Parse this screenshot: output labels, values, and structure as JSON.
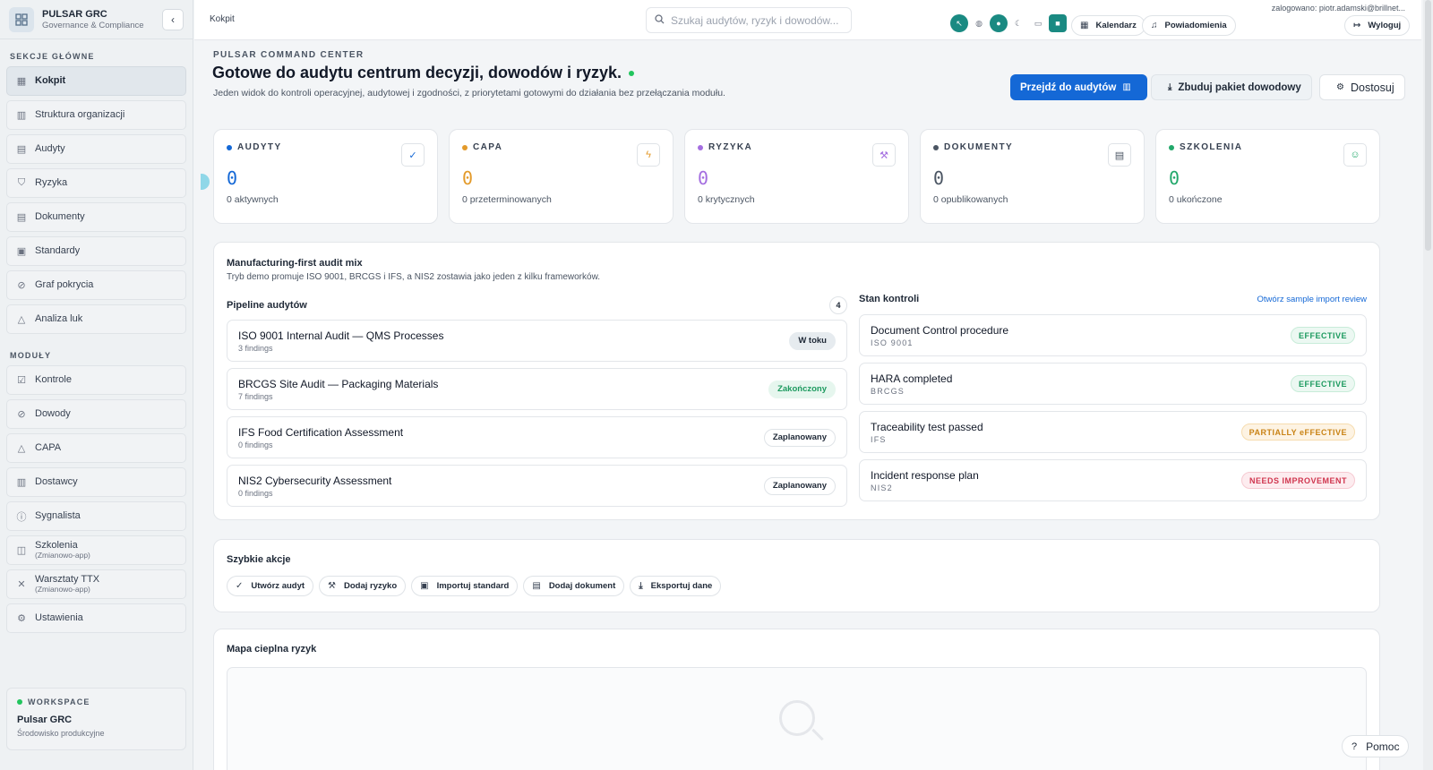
{
  "brand": {
    "title": "PULSAR GRC",
    "subtitle": "Governance & Compliance"
  },
  "sidebar": {
    "section_main": "SEKCJE GŁÓWNE",
    "main_items": [
      {
        "label": "Kokpit",
        "icon": "dashboard-icon"
      },
      {
        "label": "Struktura organizacji",
        "icon": "building-icon"
      },
      {
        "label": "Audyty",
        "icon": "clipboard-icon"
      },
      {
        "label": "Ryzyka",
        "icon": "shield-icon"
      },
      {
        "label": "Dokumenty",
        "icon": "document-icon"
      },
      {
        "label": "Standardy",
        "icon": "book-icon"
      },
      {
        "label": "Graf pokrycia",
        "icon": "check-circle-icon"
      },
      {
        "label": "Analiza luk",
        "icon": "warning-icon"
      }
    ],
    "section_modules": "MODUŁY",
    "module_items": [
      {
        "label": "Kontrole",
        "sub": "",
        "icon": "checkbox-icon"
      },
      {
        "label": "Dowody",
        "sub": "",
        "icon": "check-circle-icon"
      },
      {
        "label": "CAPA",
        "sub": "",
        "icon": "warning-icon"
      },
      {
        "label": "Dostawcy",
        "sub": "",
        "icon": "building-icon"
      },
      {
        "label": "Sygnalista",
        "sub": "",
        "icon": "info-icon"
      },
      {
        "label": "Szkolenia",
        "sub": "(Zmianowo-app)",
        "icon": "book-open-icon"
      },
      {
        "label": "Warsztaty TTX",
        "sub": "(Zmianowo-app)",
        "icon": "tools-icon"
      },
      {
        "label": "Ustawienia",
        "sub": "",
        "icon": "gear-icon"
      }
    ]
  },
  "workspace": {
    "label": "WORKSPACE",
    "name": "Pulsar GRC",
    "env": "Środowisko produkcyjne"
  },
  "topbar": {
    "breadcrumb": "Kokpit",
    "search_placeholder": "Szukaj audytów, ryzyk i dowodów...",
    "logged_in": "zalogowano: piotr.adamski@brillnet...",
    "calendar": "Kalendarz",
    "notifications": "Powiadomienia",
    "logout": "Wyloguj"
  },
  "header": {
    "eyebrow": "PULSAR COMMAND CENTER",
    "title": "Gotowe do audytu centrum decyzji, dowodów i ryzyk.",
    "lead": "Jeden widok do kontroli operacyjnej, audytowej i zgodności, z priorytetami gotowymi do działania bez przełączania modułu.",
    "btn_audits": "Przejdź do audytów",
    "btn_evidence": "Zbuduj pakiet dowodowy",
    "btn_customize": "Dostosuj"
  },
  "kpis": [
    {
      "label": "AUDYTY",
      "value": "0",
      "sub": "0 aktywnych",
      "color": "#1468d6",
      "icon": "check-icon",
      "glyph": "✓"
    },
    {
      "label": "CAPA",
      "value": "0",
      "sub": "0 przeterminowanych",
      "color": "#e39a2a",
      "icon": "lightning-icon",
      "glyph": "ϟ"
    },
    {
      "label": "RYZYKA",
      "value": "0",
      "sub": "0 krytycznych",
      "color": "#a46ee0",
      "icon": "hammer-icon",
      "glyph": "⚒"
    },
    {
      "label": "DOKUMENTY",
      "value": "0",
      "sub": "0 opublikowanych",
      "color": "#4b5563",
      "icon": "document-icon",
      "glyph": "▤"
    },
    {
      "label": "SZKOLENIA",
      "value": "0",
      "sub": "0 ukończone",
      "color": "#22a86b",
      "icon": "users-icon",
      "glyph": "☺"
    }
  ],
  "audit_mix": {
    "title": "Manufacturing-first audit mix",
    "subtitle": "Tryb demo promuje ISO 9001, BRCGS i IFS, a NIS2 zostawia jako jeden z kilku frameworków.",
    "pipeline_title": "Pipeline audytów",
    "pipeline_count": "4",
    "pipeline": [
      {
        "name": "ISO 9001 Internal Audit — QMS Processes",
        "meta": "3 findings",
        "status": "W toku",
        "bg": "#e6ebef",
        "fg": "#1f2937",
        "bd": "#e6ebef"
      },
      {
        "name": "BRCGS Site Audit — Packaging Materials",
        "meta": "7 findings",
        "status": "Zakończony",
        "bg": "#e6f6ee",
        "fg": "#1d9a5f",
        "bd": "#e6f6ee"
      },
      {
        "name": "IFS Food Certification Assessment",
        "meta": "0 findings",
        "status": "Zaplanowany",
        "bg": "#ffffff",
        "fg": "#1f2937",
        "bd": "#dfe3e7"
      },
      {
        "name": "NIS2 Cybersecurity Assessment",
        "meta": "0 findings",
        "status": "Zaplanowany",
        "bg": "#ffffff",
        "fg": "#1f2937",
        "bd": "#dfe3e7"
      }
    ],
    "controls_title": "Stan kontroli",
    "controls_link": "Otwórz sample import review",
    "controls": [
      {
        "name": "Document Control procedure",
        "framework": "ISO 9001",
        "status": "EFFECTIVE",
        "bg": "#ecf8f2",
        "fg": "#1d9a5f",
        "bd": "#c8ecd9"
      },
      {
        "name": "HARA completed",
        "framework": "BRCGS",
        "status": "EFFECTIVE",
        "bg": "#ecf8f2",
        "fg": "#1d9a5f",
        "bd": "#c8ecd9"
      },
      {
        "name": "Traceability test passed",
        "framework": "IFS",
        "status": "PARTIALLY eFFECTIVE",
        "bg": "#fdf3e3",
        "fg": "#c98316",
        "bd": "#f6dcae"
      },
      {
        "name": "Incident response plan",
        "framework": "NIS2",
        "status": "NEEDS IMPROVEMENT",
        "bg": "#fdecef",
        "fg": "#d0364f",
        "bd": "#f6c9d1"
      }
    ]
  },
  "quick_actions": {
    "title": "Szybkie akcje",
    "items": [
      {
        "label": "Utwórz audyt",
        "icon": "check-icon",
        "glyph": "✓"
      },
      {
        "label": "Dodaj ryzyko",
        "icon": "hammer-icon",
        "glyph": "⚒"
      },
      {
        "label": "Importuj standard",
        "icon": "archive-icon",
        "glyph": "▣"
      },
      {
        "label": "Dodaj dokument",
        "icon": "document-icon",
        "glyph": "▤"
      },
      {
        "label": "Eksportuj dane",
        "icon": "download-icon",
        "glyph": "⤓"
      }
    ]
  },
  "heatmap": {
    "title": "Mapa cieplna ryzyk"
  },
  "help": {
    "label": "Pomoc"
  }
}
